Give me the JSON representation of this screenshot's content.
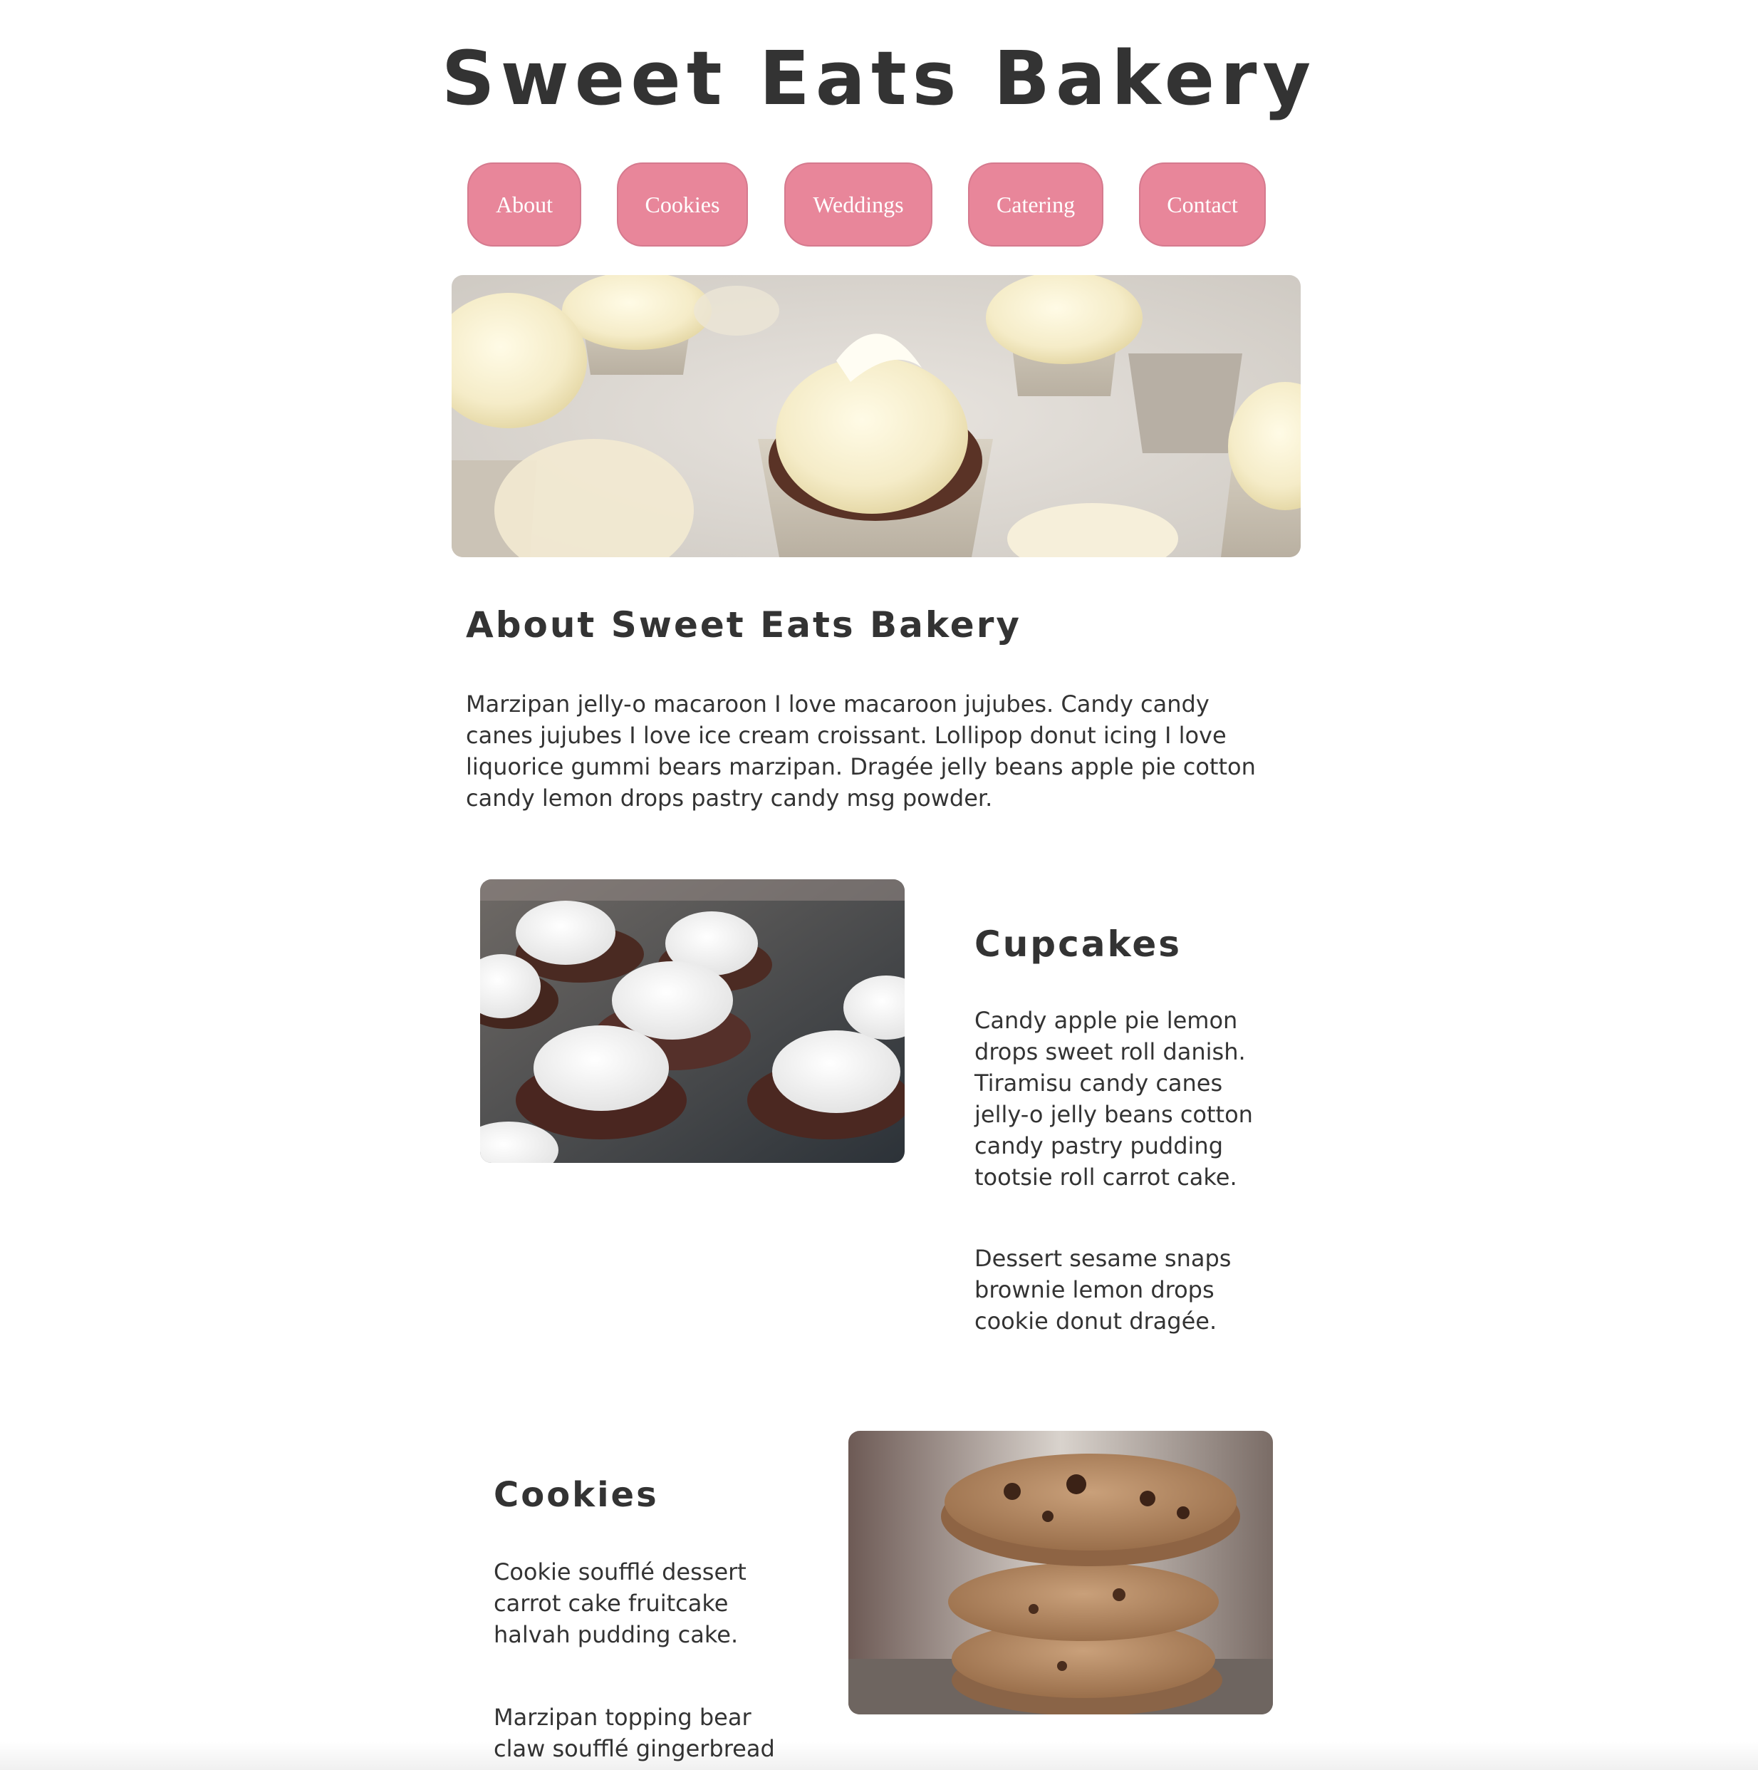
{
  "site": {
    "title": "Sweet Eats Bakery"
  },
  "nav": {
    "items": [
      "About",
      "Cookies",
      "Weddings",
      "Catering",
      "Contact"
    ]
  },
  "about": {
    "heading": "About Sweet Eats Bakery",
    "text": "Marzipan jelly-o macaroon I love macaroon jujubes. Candy candy canes jujubes I love ice cream croissant. Lollipop donut icing I love liquorice gummi bears marzipan. Dragée jelly beans apple pie cotton candy lemon drops pastry candy msg powder."
  },
  "cupcakes": {
    "heading": "Cupcakes",
    "paragraph1": "Candy apple pie lemon drops sweet roll danish. Tiramisu candy canes jelly-o jelly beans cotton candy pastry pudding tootsie roll carrot cake.",
    "paragraph2": "Dessert sesame snaps brownie lemon drops cookie donut dragée."
  },
  "cookies": {
    "heading": "Cookies",
    "paragraph1": "Cookie soufflé dessert carrot cake fruitcake halvah pudding cake.",
    "paragraph2": "Marzipan topping bear claw soufflé gingerbread biscuit."
  },
  "colors": {
    "nav_button": "#e8869a",
    "text": "#333333",
    "background": "#ffffff"
  }
}
